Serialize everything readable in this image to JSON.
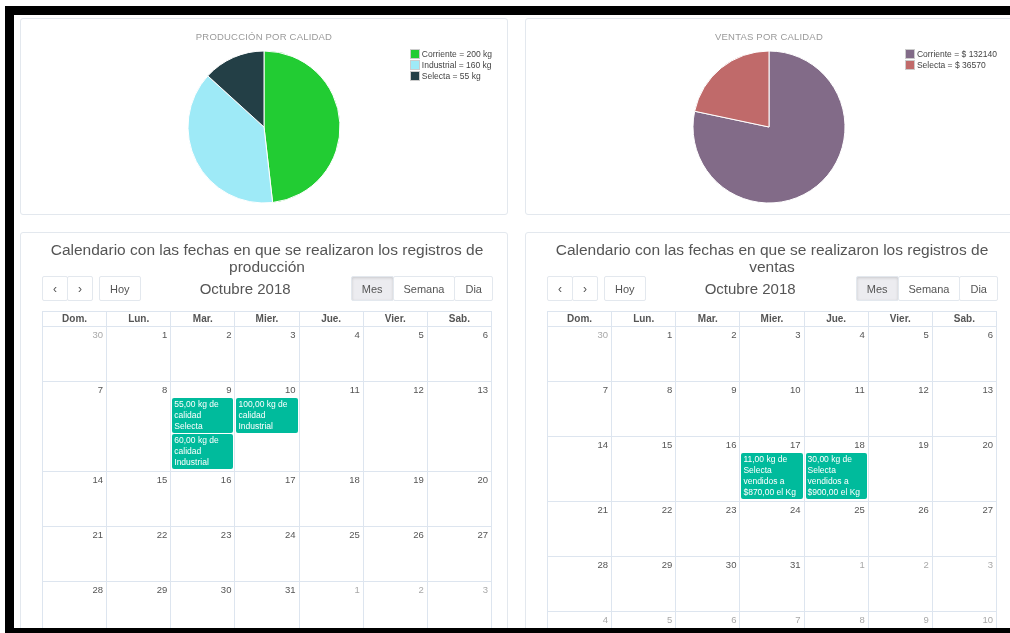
{
  "charts": [
    {
      "chart_data": {
        "type": "pie",
        "title": "PRODUCCIÓN POR CALIDAD",
        "categories": [
          "Corriente = 200 kg",
          "Industrial = 160 kg",
          "Selecta = 55 kg"
        ],
        "values": [
          200,
          160,
          55
        ],
        "colors": [
          "#22cc33",
          "#9eeaf7",
          "#233f46"
        ]
      }
    },
    {
      "chart_data": {
        "type": "pie",
        "title": "VENTAS POR CALIDAD",
        "categories": [
          "Corriente = $ 132140",
          "Selecta = $ 36570"
        ],
        "values": [
          132140,
          36570
        ],
        "colors": [
          "#826b88",
          "#c06a6a"
        ]
      }
    }
  ],
  "calendars": [
    {
      "title": "Calendario con las fechas en que se realizaron los registros de producción",
      "prev": "‹",
      "next": "›",
      "today": "Hoy",
      "month": "Octubre 2018",
      "views": [
        {
          "label": "Mes",
          "selected": true
        },
        {
          "label": "Semana",
          "selected": false
        },
        {
          "label": "Dia",
          "selected": false
        }
      ],
      "weekdays": [
        "Dom.",
        "Lun.",
        "Mar.",
        "Mier.",
        "Jue.",
        "Vier.",
        "Sab."
      ],
      "weeks": [
        [
          {
            "day": "30",
            "other_month": true
          },
          {
            "day": "1",
            "other_month": false
          },
          {
            "day": "2",
            "other_month": false
          },
          {
            "day": "3",
            "other_month": false
          },
          {
            "day": "4",
            "other_month": false
          },
          {
            "day": "5",
            "other_month": false
          },
          {
            "day": "6",
            "other_month": false
          }
        ],
        [
          {
            "day": "7",
            "other_month": false
          },
          {
            "day": "8",
            "other_month": false
          },
          {
            "day": "9",
            "other_month": false,
            "events": [
              "55,00 kg de calidad Selecta",
              "60,00 kg de calidad Industrial"
            ]
          },
          {
            "day": "10",
            "other_month": false,
            "events": [
              "100,00 kg de calidad Industrial"
            ]
          },
          {
            "day": "11",
            "other_month": false
          },
          {
            "day": "12",
            "other_month": false
          },
          {
            "day": "13",
            "other_month": false
          }
        ],
        [
          {
            "day": "14",
            "other_month": false
          },
          {
            "day": "15",
            "other_month": false
          },
          {
            "day": "16",
            "other_month": false
          },
          {
            "day": "17",
            "other_month": false
          },
          {
            "day": "18",
            "other_month": false
          },
          {
            "day": "19",
            "other_month": false
          },
          {
            "day": "20",
            "other_month": false
          }
        ],
        [
          {
            "day": "21",
            "other_month": false
          },
          {
            "day": "22",
            "other_month": false
          },
          {
            "day": "23",
            "other_month": false
          },
          {
            "day": "24",
            "other_month": false
          },
          {
            "day": "25",
            "other_month": false
          },
          {
            "day": "26",
            "other_month": false
          },
          {
            "day": "27",
            "other_month": false
          }
        ],
        [
          {
            "day": "28",
            "other_month": false
          },
          {
            "day": "29",
            "other_month": false
          },
          {
            "day": "30",
            "other_month": false
          },
          {
            "day": "31",
            "other_month": false
          },
          {
            "day": "1",
            "other_month": true
          },
          {
            "day": "2",
            "other_month": true
          },
          {
            "day": "3",
            "other_month": true
          }
        ]
      ]
    },
    {
      "title": "Calendario con las fechas en que se realizaron los registros de ventas",
      "prev": "‹",
      "next": "›",
      "today": "Hoy",
      "month": "Octubre 2018",
      "views": [
        {
          "label": "Mes",
          "selected": true
        },
        {
          "label": "Semana",
          "selected": false
        },
        {
          "label": "Dia",
          "selected": false
        }
      ],
      "weekdays": [
        "Dom.",
        "Lun.",
        "Mar.",
        "Mier.",
        "Jue.",
        "Vier.",
        "Sab."
      ],
      "weeks": [
        [
          {
            "day": "30",
            "other_month": true
          },
          {
            "day": "1",
            "other_month": false
          },
          {
            "day": "2",
            "other_month": false
          },
          {
            "day": "3",
            "other_month": false
          },
          {
            "day": "4",
            "other_month": false
          },
          {
            "day": "5",
            "other_month": false
          },
          {
            "day": "6",
            "other_month": false
          }
        ],
        [
          {
            "day": "7",
            "other_month": false
          },
          {
            "day": "8",
            "other_month": false
          },
          {
            "day": "9",
            "other_month": false
          },
          {
            "day": "10",
            "other_month": false
          },
          {
            "day": "11",
            "other_month": false
          },
          {
            "day": "12",
            "other_month": false
          },
          {
            "day": "13",
            "other_month": false
          }
        ],
        [
          {
            "day": "14",
            "other_month": false
          },
          {
            "day": "15",
            "other_month": false
          },
          {
            "day": "16",
            "other_month": false
          },
          {
            "day": "17",
            "other_month": false,
            "events": [
              "11,00 kg de Selecta vendidos a $870,00 el Kg"
            ]
          },
          {
            "day": "18",
            "other_month": false,
            "events": [
              "30,00 kg de Selecta vendidos a $900,00 el Kg"
            ]
          },
          {
            "day": "19",
            "other_month": false
          },
          {
            "day": "20",
            "other_month": false
          }
        ],
        [
          {
            "day": "21",
            "other_month": false
          },
          {
            "day": "22",
            "other_month": false
          },
          {
            "day": "23",
            "other_month": false
          },
          {
            "day": "24",
            "other_month": false
          },
          {
            "day": "25",
            "other_month": false
          },
          {
            "day": "26",
            "other_month": false
          },
          {
            "day": "27",
            "other_month": false
          }
        ],
        [
          {
            "day": "28",
            "other_month": false
          },
          {
            "day": "29",
            "other_month": false
          },
          {
            "day": "30",
            "other_month": false
          },
          {
            "day": "31",
            "other_month": false
          },
          {
            "day": "1",
            "other_month": true
          },
          {
            "day": "2",
            "other_month": true
          },
          {
            "day": "3",
            "other_month": true
          }
        ],
        [
          {
            "day": "4",
            "other_month": true
          },
          {
            "day": "5",
            "other_month": true
          },
          {
            "day": "6",
            "other_month": true
          },
          {
            "day": "7",
            "other_month": true
          },
          {
            "day": "8",
            "other_month": true
          },
          {
            "day": "9",
            "other_month": true
          },
          {
            "day": "10",
            "other_month": true
          }
        ]
      ]
    }
  ]
}
